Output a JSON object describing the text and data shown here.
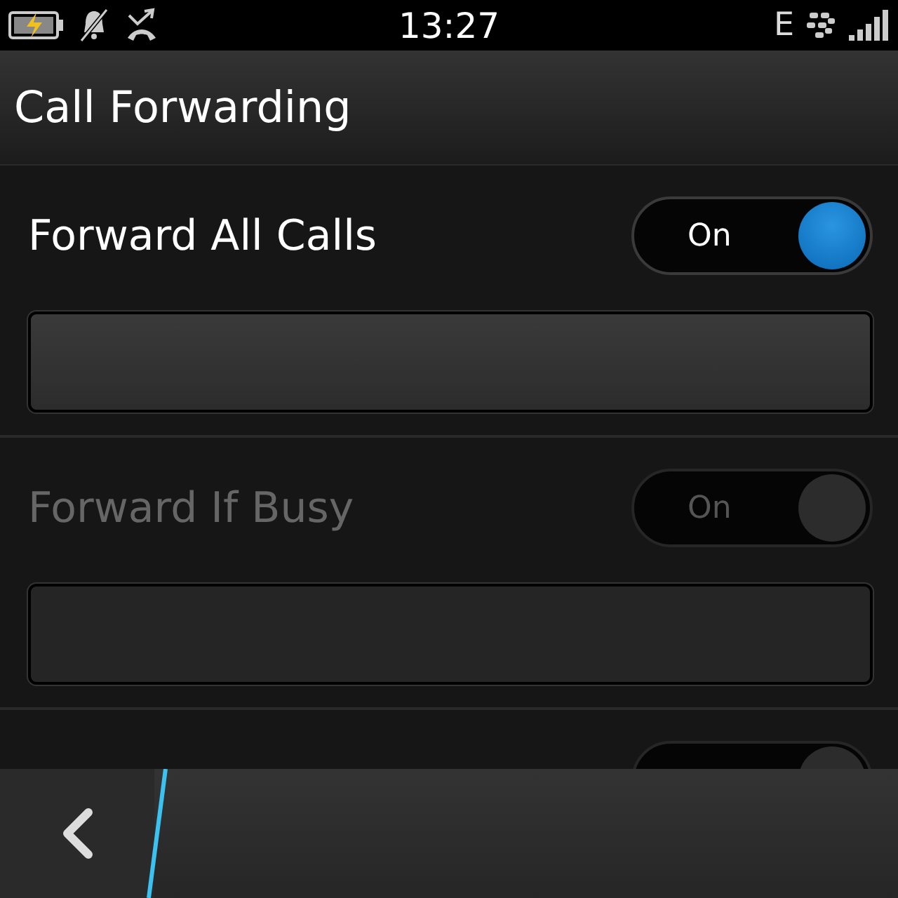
{
  "status_bar": {
    "time": "13:27",
    "network": "E"
  },
  "title": "Call Forwarding",
  "rows": [
    {
      "label": "Forward All Calls",
      "toggle_text": "On",
      "on": true,
      "disabled": false
    },
    {
      "label": "Forward If Busy",
      "toggle_text": "On",
      "on": true,
      "disabled": true
    },
    {
      "on": true,
      "disabled": true
    }
  ]
}
